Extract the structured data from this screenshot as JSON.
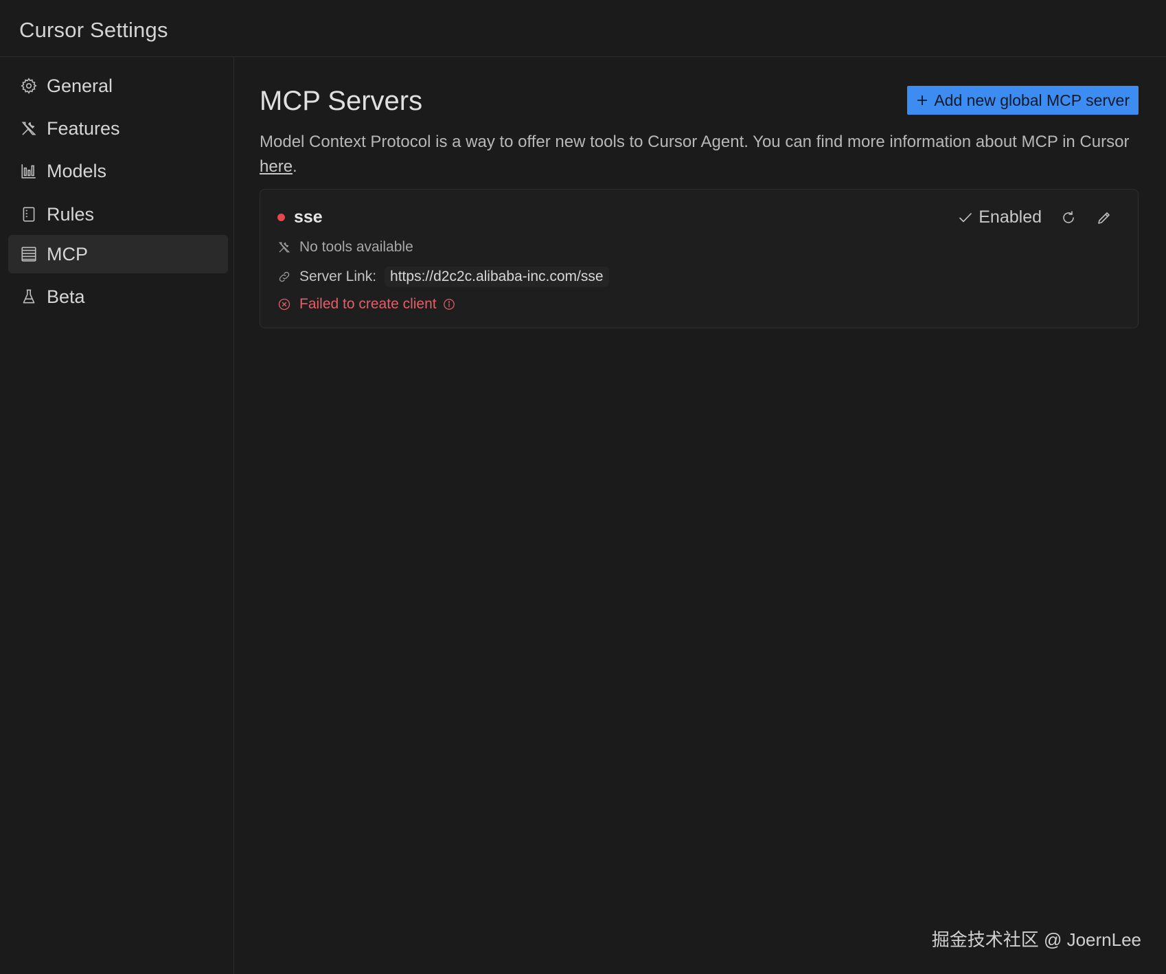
{
  "window": {
    "title": "Cursor Settings"
  },
  "sidebar": {
    "items": [
      {
        "label": "General",
        "icon": "gear-icon",
        "active": false
      },
      {
        "label": "Features",
        "icon": "tools-icon",
        "active": false
      },
      {
        "label": "Models",
        "icon": "bar-chart-icon",
        "active": false
      },
      {
        "label": "Rules",
        "icon": "book-icon",
        "active": false
      },
      {
        "label": "MCP",
        "icon": "server-icon",
        "active": true
      },
      {
        "label": "Beta",
        "icon": "flask-icon",
        "active": false
      }
    ]
  },
  "main": {
    "title": "MCP Servers",
    "add_button_label": "Add new global MCP server",
    "description_prefix": "Model Context Protocol is a way to offer new tools to Cursor Agent. You can find more information about MCP in Cursor ",
    "description_link": "here",
    "description_suffix": ".",
    "server": {
      "name": "sse",
      "status_color": "#e5484d",
      "enabled_label": "Enabled",
      "tools_text": "No tools available",
      "link_label": "Server Link:",
      "link_value": "https://d2c2c.alibaba-inc.com/sse",
      "error_text": "Failed to create client"
    }
  },
  "watermark": "掘金技术社区 @ JoernLee",
  "colors": {
    "accent": "#3d8cf2",
    "error": "#e0606a",
    "background": "#1b1b1b"
  }
}
